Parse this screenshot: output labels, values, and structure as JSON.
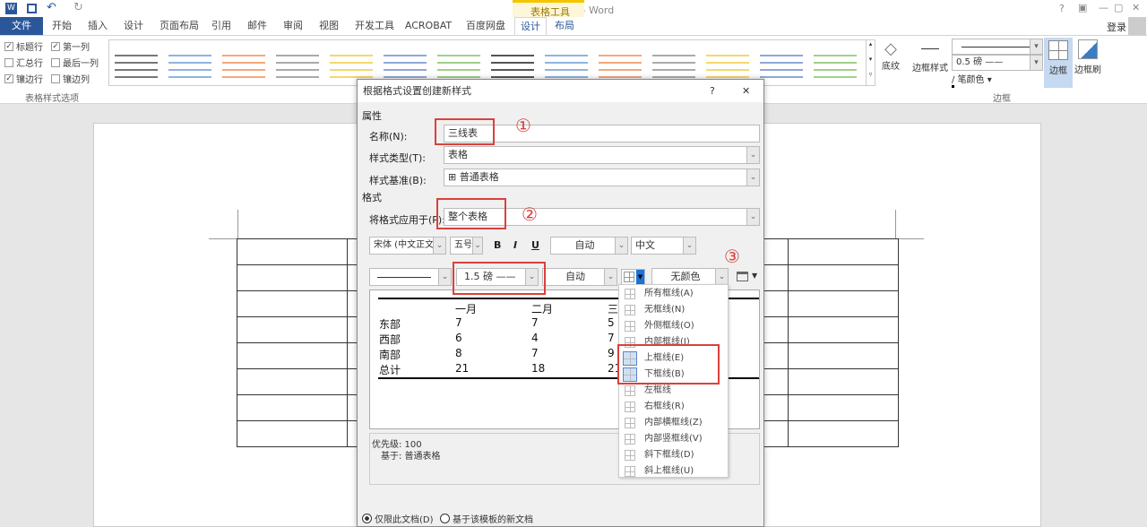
{
  "window": {
    "title": "文档2 - Word",
    "context_tab_group": "表格工具",
    "login": "登录",
    "help": "?",
    "ribbon_opts": "▣",
    "minimize": "—",
    "restore": "▢",
    "close": "✕"
  },
  "tabs": [
    "文件",
    "开始",
    "插入",
    "设计",
    "页面布局",
    "引用",
    "邮件",
    "审阅",
    "视图",
    "开发工具",
    "ACROBAT",
    "百度网盘",
    "设计",
    "布局"
  ],
  "ribbon": {
    "options": [
      {
        "label": "标题行",
        "checked": true
      },
      {
        "label": "第一列",
        "checked": true
      },
      {
        "label": "汇总行",
        "checked": false
      },
      {
        "label": "最后一列",
        "checked": false
      },
      {
        "label": "镶边行",
        "checked": true
      },
      {
        "label": "镶边列",
        "checked": false
      }
    ],
    "options_group": "表格样式选项",
    "shading": "底纹",
    "border_styles": "边框样式",
    "pen_weight": "0.5 磅",
    "pen_color": "笔颜色",
    "borders": "边框",
    "border_painter": "边框刷",
    "borders_group": "边框",
    "style_colors": [
      "#777777",
      "#8fb4e0",
      "#f2a77e",
      "#aaaaaa",
      "#f5d86a",
      "#8fa8d8",
      "#9fd08a",
      "#555555",
      "#8fb4e0",
      "#f2a77e",
      "#aaaaaa",
      "#f5d86a",
      "#8fa8d8",
      "#9fd08a"
    ]
  },
  "dialog": {
    "title": "根据格式设置创建新样式",
    "help": "?",
    "close": "✕",
    "properties_section": "属性",
    "name_label": "名称(N):",
    "name_value": "三线表",
    "style_type_label": "样式类型(T):",
    "style_type_value": "表格",
    "based_on_label": "样式基准(B):",
    "based_on_value": "⊞ 普通表格",
    "format_section": "格式",
    "apply_to_label": "将格式应用于(P):",
    "apply_to_value": "整个表格",
    "font": "宋体 (中文正文)",
    "size": "五号",
    "bold": "B",
    "italic": "I",
    "underline": "U",
    "font_color": "自动",
    "script": "中文",
    "line_weight": "1.5 磅",
    "line_color": "自动",
    "shading_color": "无颜色",
    "annotations": [
      "①",
      "②",
      "③"
    ],
    "preview": {
      "headers": [
        "",
        "一月",
        "二月",
        "三"
      ],
      "rows": [
        [
          "东部",
          "7",
          "7",
          "5"
        ],
        [
          "西部",
          "6",
          "4",
          "7"
        ],
        [
          "南部",
          "8",
          "7",
          "9"
        ],
        [
          "总计",
          "21",
          "18",
          "21"
        ]
      ]
    },
    "priority": "优先级: 100",
    "based_on_desc": "基于: 普通表格",
    "radio_doc": "仅限此文档(D)",
    "radio_template": "基于该模板的新文档"
  },
  "border_menu": [
    "所有框线(A)",
    "无框线(N)",
    "外侧框线(O)",
    "内部框线(I)",
    "上框线(E)",
    "下框线(B)",
    "左框线",
    "右框线(R)",
    "内部横框线(Z)",
    "内部竖框线(V)",
    "斜下框线(D)",
    "斜上框线(U)"
  ]
}
